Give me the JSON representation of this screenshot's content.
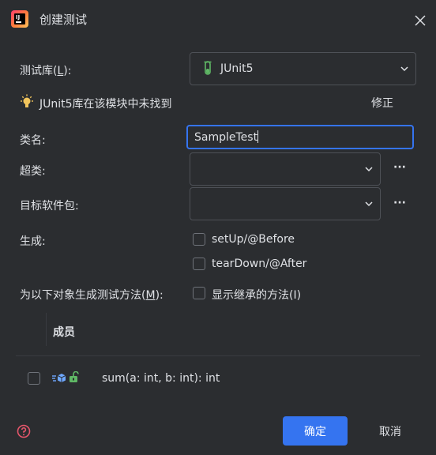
{
  "window": {
    "title": "创建测试"
  },
  "library": {
    "label_prefix": "测试库(",
    "label_mnemonic": "L",
    "label_suffix": "):",
    "value": "JUnit5",
    "warning": "JUnit5库在该模块中未找到",
    "fix_label": "修正"
  },
  "class_name": {
    "label": "类名:",
    "value": "SampleTest"
  },
  "superclass": {
    "label": "超类:",
    "value": ""
  },
  "target_package": {
    "label": "目标软件包:",
    "value": ""
  },
  "generate": {
    "label": "生成:",
    "options": [
      {
        "label": "setUp/@Before",
        "checked": false
      },
      {
        "label": "tearDown/@After",
        "checked": false
      }
    ]
  },
  "methods": {
    "label_prefix": "为以下对象生成测试方法(",
    "label_mnemonic": "M",
    "label_suffix": "):",
    "show_inherited": "显示继承的方法(I)"
  },
  "members": {
    "header": "成员",
    "rows": [
      {
        "signature": "sum(a: int, b: int): int",
        "checked": false
      }
    ]
  },
  "footer": {
    "ok": "确定",
    "cancel": "取消"
  },
  "colors": {
    "accent": "#3574f0",
    "background": "#2b2d30",
    "border": "#4e5157"
  },
  "icons": [
    "app-logo-icon",
    "close-icon",
    "test-tube-icon",
    "chevron-down-icon",
    "lightbulb-icon",
    "method-icon",
    "unlocked-icon",
    "help-icon"
  ]
}
